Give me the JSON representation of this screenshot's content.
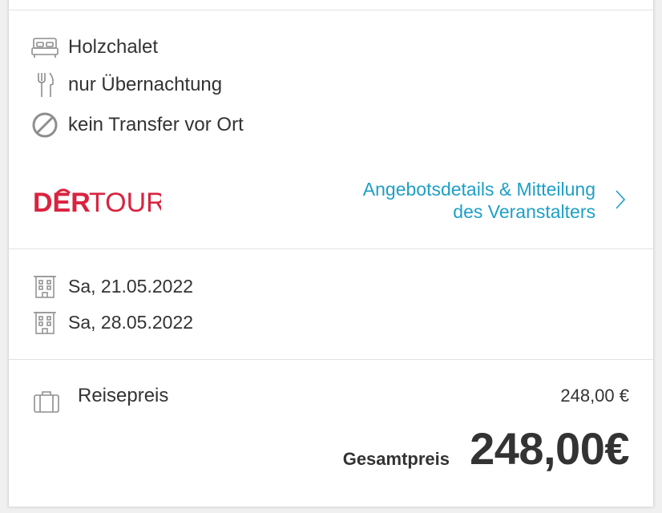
{
  "features": [
    {
      "icon": "bed-icon",
      "label": "Holzchalet"
    },
    {
      "icon": "cutlery-icon",
      "label": "nur Übernachtung"
    },
    {
      "icon": "no-transfer-icon",
      "label": "kein Transfer vor Ort"
    }
  ],
  "operator": {
    "logo_text_red": "DER",
    "logo_text_rest": "TOUR",
    "details_link_line1": "Angebotsdetails & Mitteilung",
    "details_link_line2": "des Veranstalters"
  },
  "dates": [
    {
      "icon": "hotel-icon",
      "label": "Sa, 21.05.2022"
    },
    {
      "icon": "hotel-icon",
      "label": "Sa, 28.05.2022"
    }
  ],
  "price": {
    "icon": "suitcase-icon",
    "label": "Reisepreis",
    "value": "248,00 €",
    "total_label": "Gesamtpreis",
    "total_value": "248,00€"
  },
  "colors": {
    "link": "#1e9fc6",
    "brand_red": "#d9233f",
    "text": "#333333",
    "icon_gray": "#9a9a9a"
  }
}
